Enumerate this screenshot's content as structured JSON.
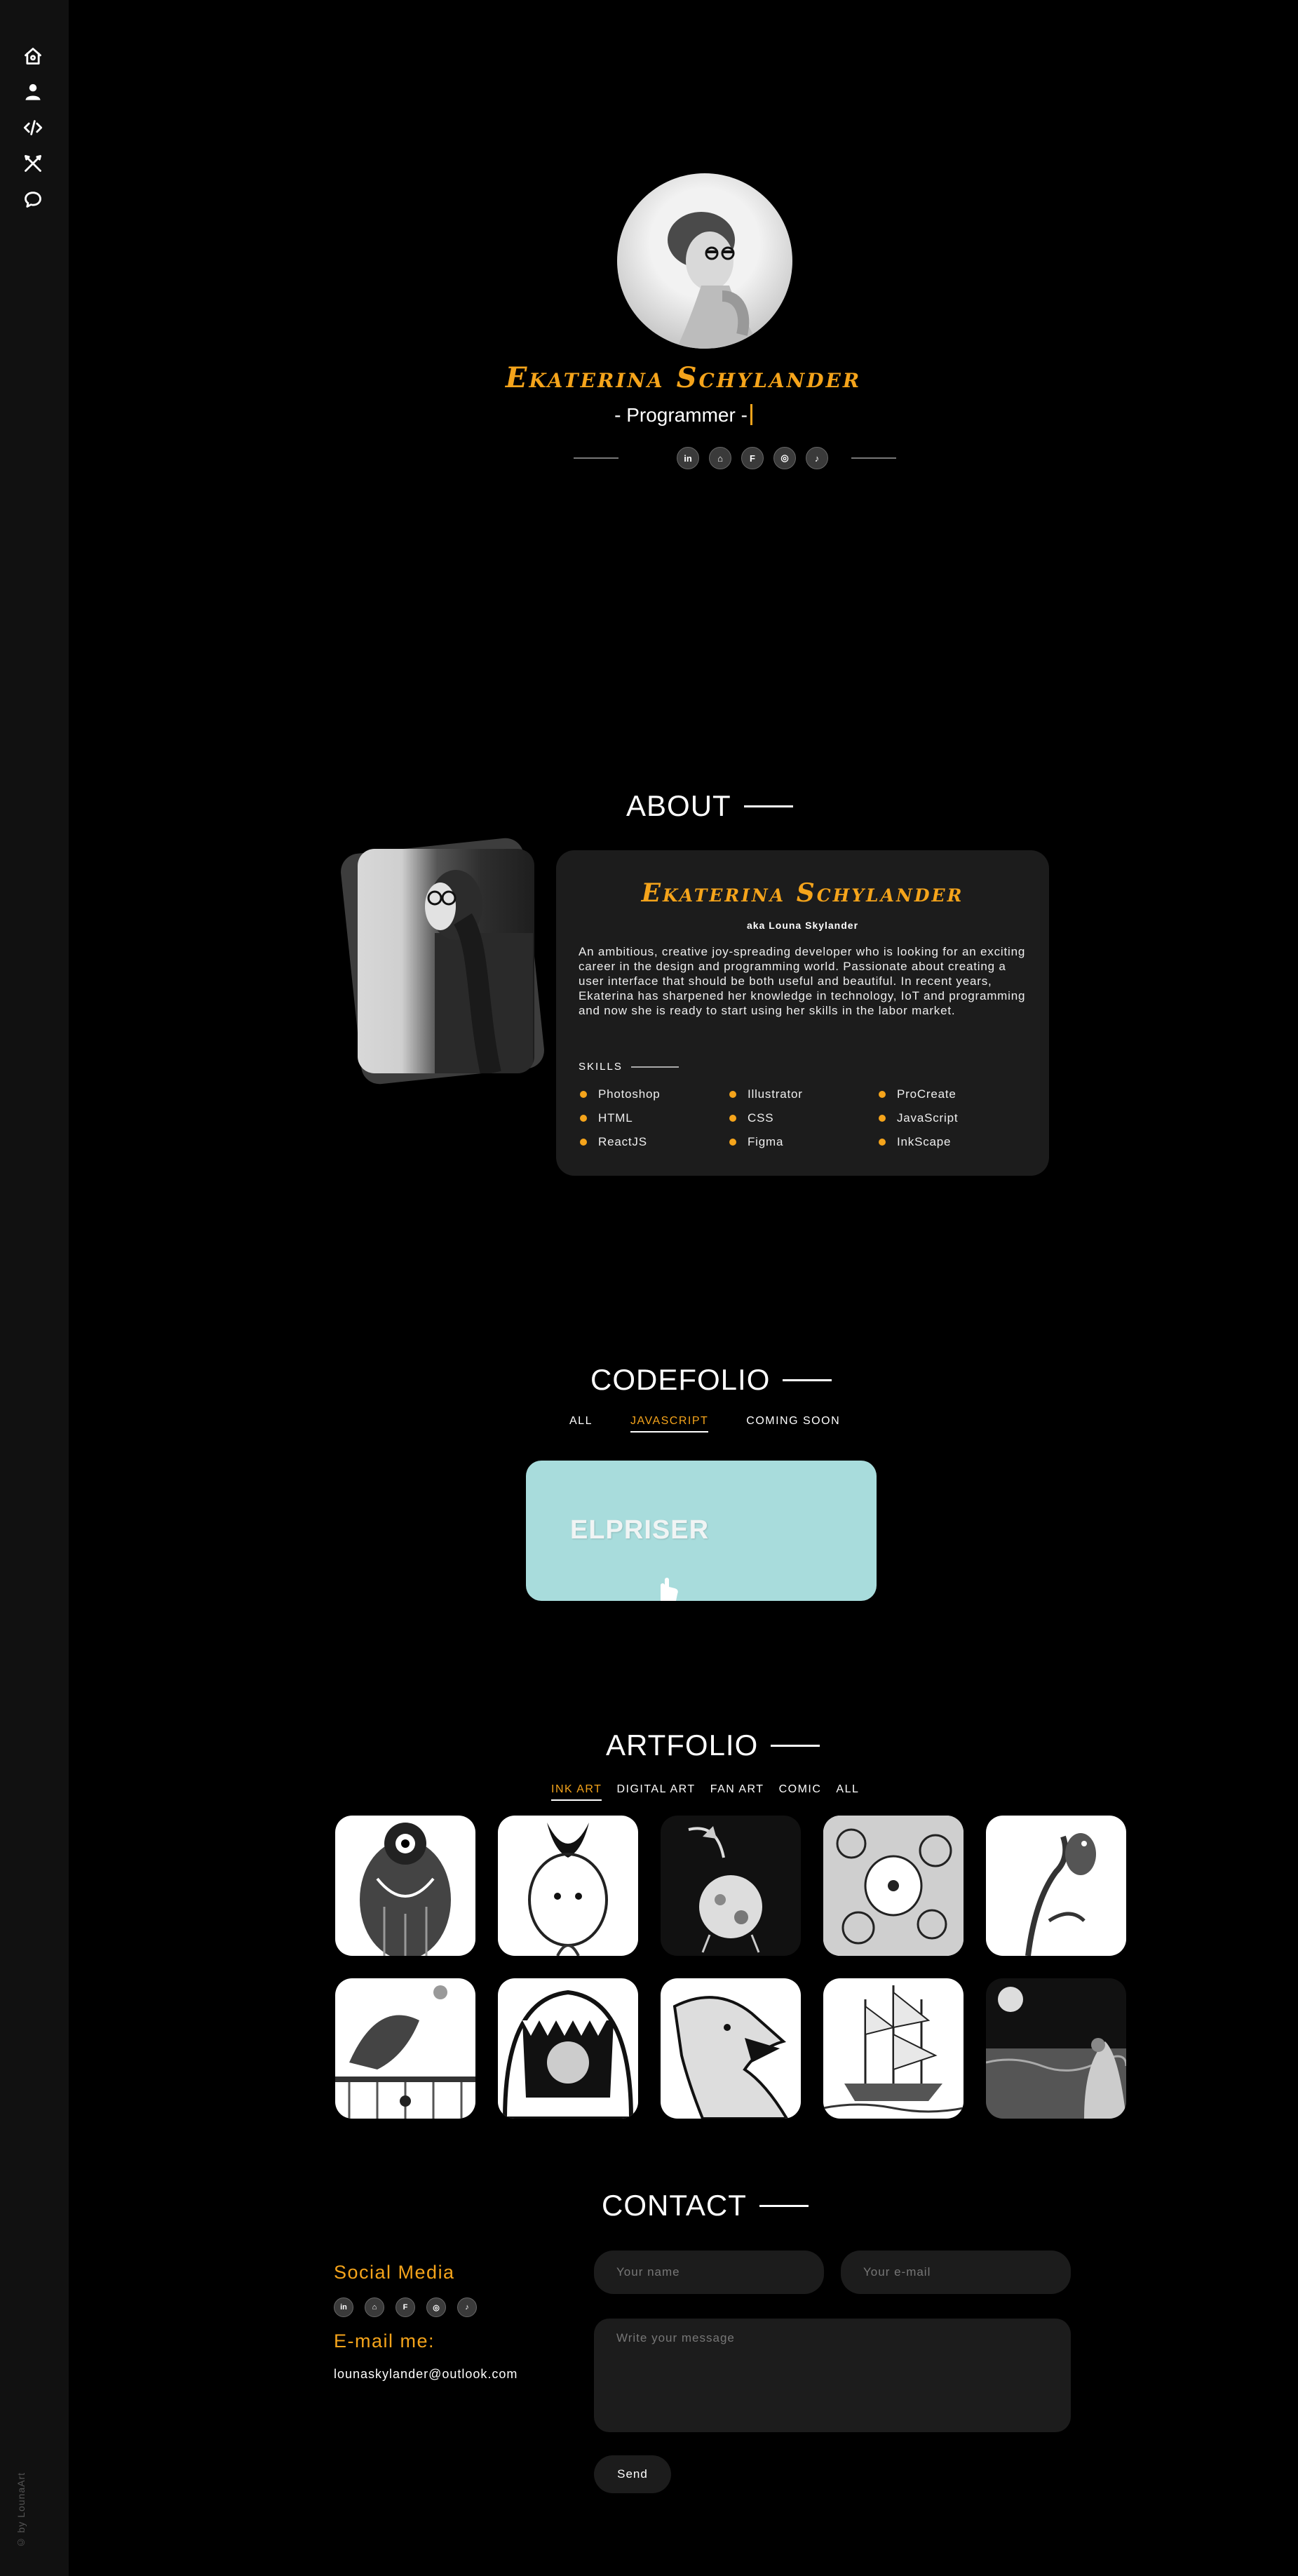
{
  "sidebar": {
    "items": [
      {
        "icon": "home-icon"
      },
      {
        "icon": "user-icon"
      },
      {
        "icon": "code-icon"
      },
      {
        "icon": "brushes-icon"
      },
      {
        "icon": "chat-icon"
      }
    ],
    "copyright": "© by LounaArt"
  },
  "hero": {
    "name": "Ekaterina Schylander",
    "role": "- Programmer -",
    "social": [
      {
        "icon": "linkedin-icon",
        "glyph": "in"
      },
      {
        "icon": "github-icon",
        "glyph": "⌂"
      },
      {
        "icon": "freecodecamp-icon",
        "glyph": "F"
      },
      {
        "icon": "instagram-icon",
        "glyph": "◎"
      },
      {
        "icon": "tiktok-icon",
        "glyph": "♪"
      }
    ]
  },
  "about": {
    "title": "ABOUT",
    "name": "Ekaterina Schylander",
    "aka": "aka Louna Skylander",
    "text": "An ambitious, creative joy-spreading developer who is looking for an exciting career in the design and programming world. Passionate about creating a user interface that should be both useful and beautiful. In recent years, Ekaterina has sharpened her knowledge in technology, IoT and programming and now she is ready to start using her skills in the labor market.",
    "skills_title": "SKILLS",
    "skills": [
      "Photoshop",
      "Illustrator",
      "ProCreate",
      "HTML",
      "CSS",
      "JavaScript",
      "ReactJS",
      "Figma",
      "InkScape"
    ]
  },
  "codefolio": {
    "title": "CODEFOLIO",
    "filters": [
      "ALL",
      "JAVASCRIPT",
      "COMING SOON"
    ],
    "active_filter": "JAVASCRIPT",
    "projects": [
      {
        "title": "ELPRISER",
        "color": "#a8dcdc"
      }
    ]
  },
  "artfolio": {
    "title": "ARTFOLIO",
    "filters": [
      "INK ART",
      "DIGITAL ART",
      "FAN ART",
      "COMIC",
      "ALL"
    ],
    "active_filter": "INK ART"
  },
  "contact": {
    "title": "CONTACT",
    "social_heading": "Social Media",
    "email_heading": "E-mail me:",
    "email": "lounaskylander@outlook.com",
    "name_placeholder": "Your name",
    "email_placeholder": "Your e-mail",
    "message_placeholder": "Write your message",
    "send_label": "Send"
  },
  "colors": {
    "accent": "#f5a41b",
    "background": "#000000",
    "card": "#1c1c1c",
    "sidebar": "#111111"
  }
}
